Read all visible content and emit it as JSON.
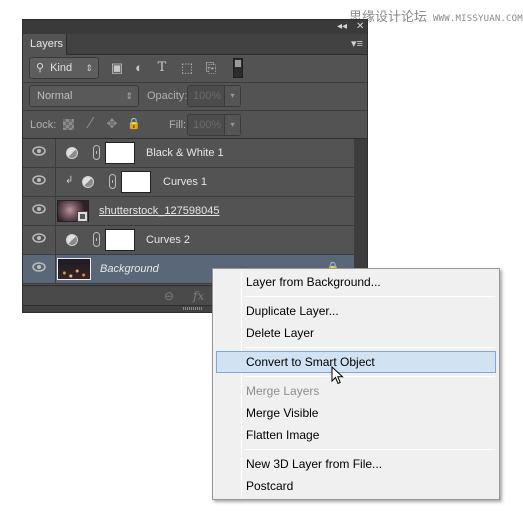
{
  "watermark": {
    "cn_text": "思缘设计论坛",
    "url": "WWW.MISSYUAN.COM"
  },
  "panel": {
    "titlebar": {
      "collapse_icon": "double-chevron-left-icon",
      "collapse_glyph": "◂◂",
      "close_glyph": "✕"
    },
    "tab": {
      "label": "Layers"
    },
    "menu_glyph": "▾≡",
    "filter": {
      "kind_label": "Kind",
      "kind_icon_glyph": "⚲",
      "spin_glyph": "⇕",
      "icons": [
        {
          "name": "pixel-layer-filter-icon",
          "glyph": "▣"
        },
        {
          "name": "adjustment-layer-filter-icon",
          "glyph": "◐"
        },
        {
          "name": "type-layer-filter-icon",
          "glyph": "T"
        },
        {
          "name": "shape-layer-filter-icon",
          "glyph": "⬚"
        },
        {
          "name": "smart-object-filter-icon",
          "glyph": "⎘"
        }
      ]
    },
    "blend": {
      "mode": "Normal",
      "opacity_label": "Opacity:",
      "opacity_value": "100%",
      "drop_glyph": "▾"
    },
    "lock": {
      "label": "Lock:",
      "brush_glyph": "⁄",
      "move_glyph": "✥",
      "lock_glyph": "🔒",
      "fill_label": "Fill:",
      "fill_value": "100%"
    },
    "layers": [
      {
        "name": "Black & White 1",
        "type": "adjustment",
        "clipped": false,
        "selected": false
      },
      {
        "name": "Curves 1",
        "type": "adjustment",
        "clipped": true,
        "selected": false
      },
      {
        "name": "shutterstock_127598045",
        "type": "smart-object",
        "clipped": false,
        "selected": false
      },
      {
        "name": "Curves 2",
        "type": "adjustment",
        "clipped": false,
        "selected": false
      },
      {
        "name": "Background",
        "type": "background",
        "clipped": false,
        "selected": true,
        "locked": true
      }
    ],
    "clip_glyph": "↲",
    "footer": {
      "link_glyph": "⊖",
      "fx_glyph": "fx"
    }
  },
  "context_menu": {
    "items": [
      {
        "label": "Layer from Background...",
        "enabled": true,
        "hover": false
      },
      {
        "label": "Duplicate Layer...",
        "enabled": true,
        "hover": false
      },
      {
        "label": "Delete Layer",
        "enabled": true,
        "hover": false
      },
      {
        "label": "Convert to Smart Object",
        "enabled": true,
        "hover": true
      },
      {
        "label": "Merge Layers",
        "enabled": false,
        "hover": false
      },
      {
        "label": "Merge Visible",
        "enabled": true,
        "hover": false
      },
      {
        "label": "Flatten Image",
        "enabled": true,
        "hover": false
      },
      {
        "label": "New 3D Layer from File...",
        "enabled": true,
        "hover": false
      },
      {
        "label": "Postcard",
        "enabled": true,
        "hover": false
      }
    ]
  },
  "colors": {
    "panel_bg": "#535353",
    "selected_row": "#5a6778",
    "menu_hover": "#d1e2f2",
    "menu_hover_border": "#7aa8d8"
  }
}
